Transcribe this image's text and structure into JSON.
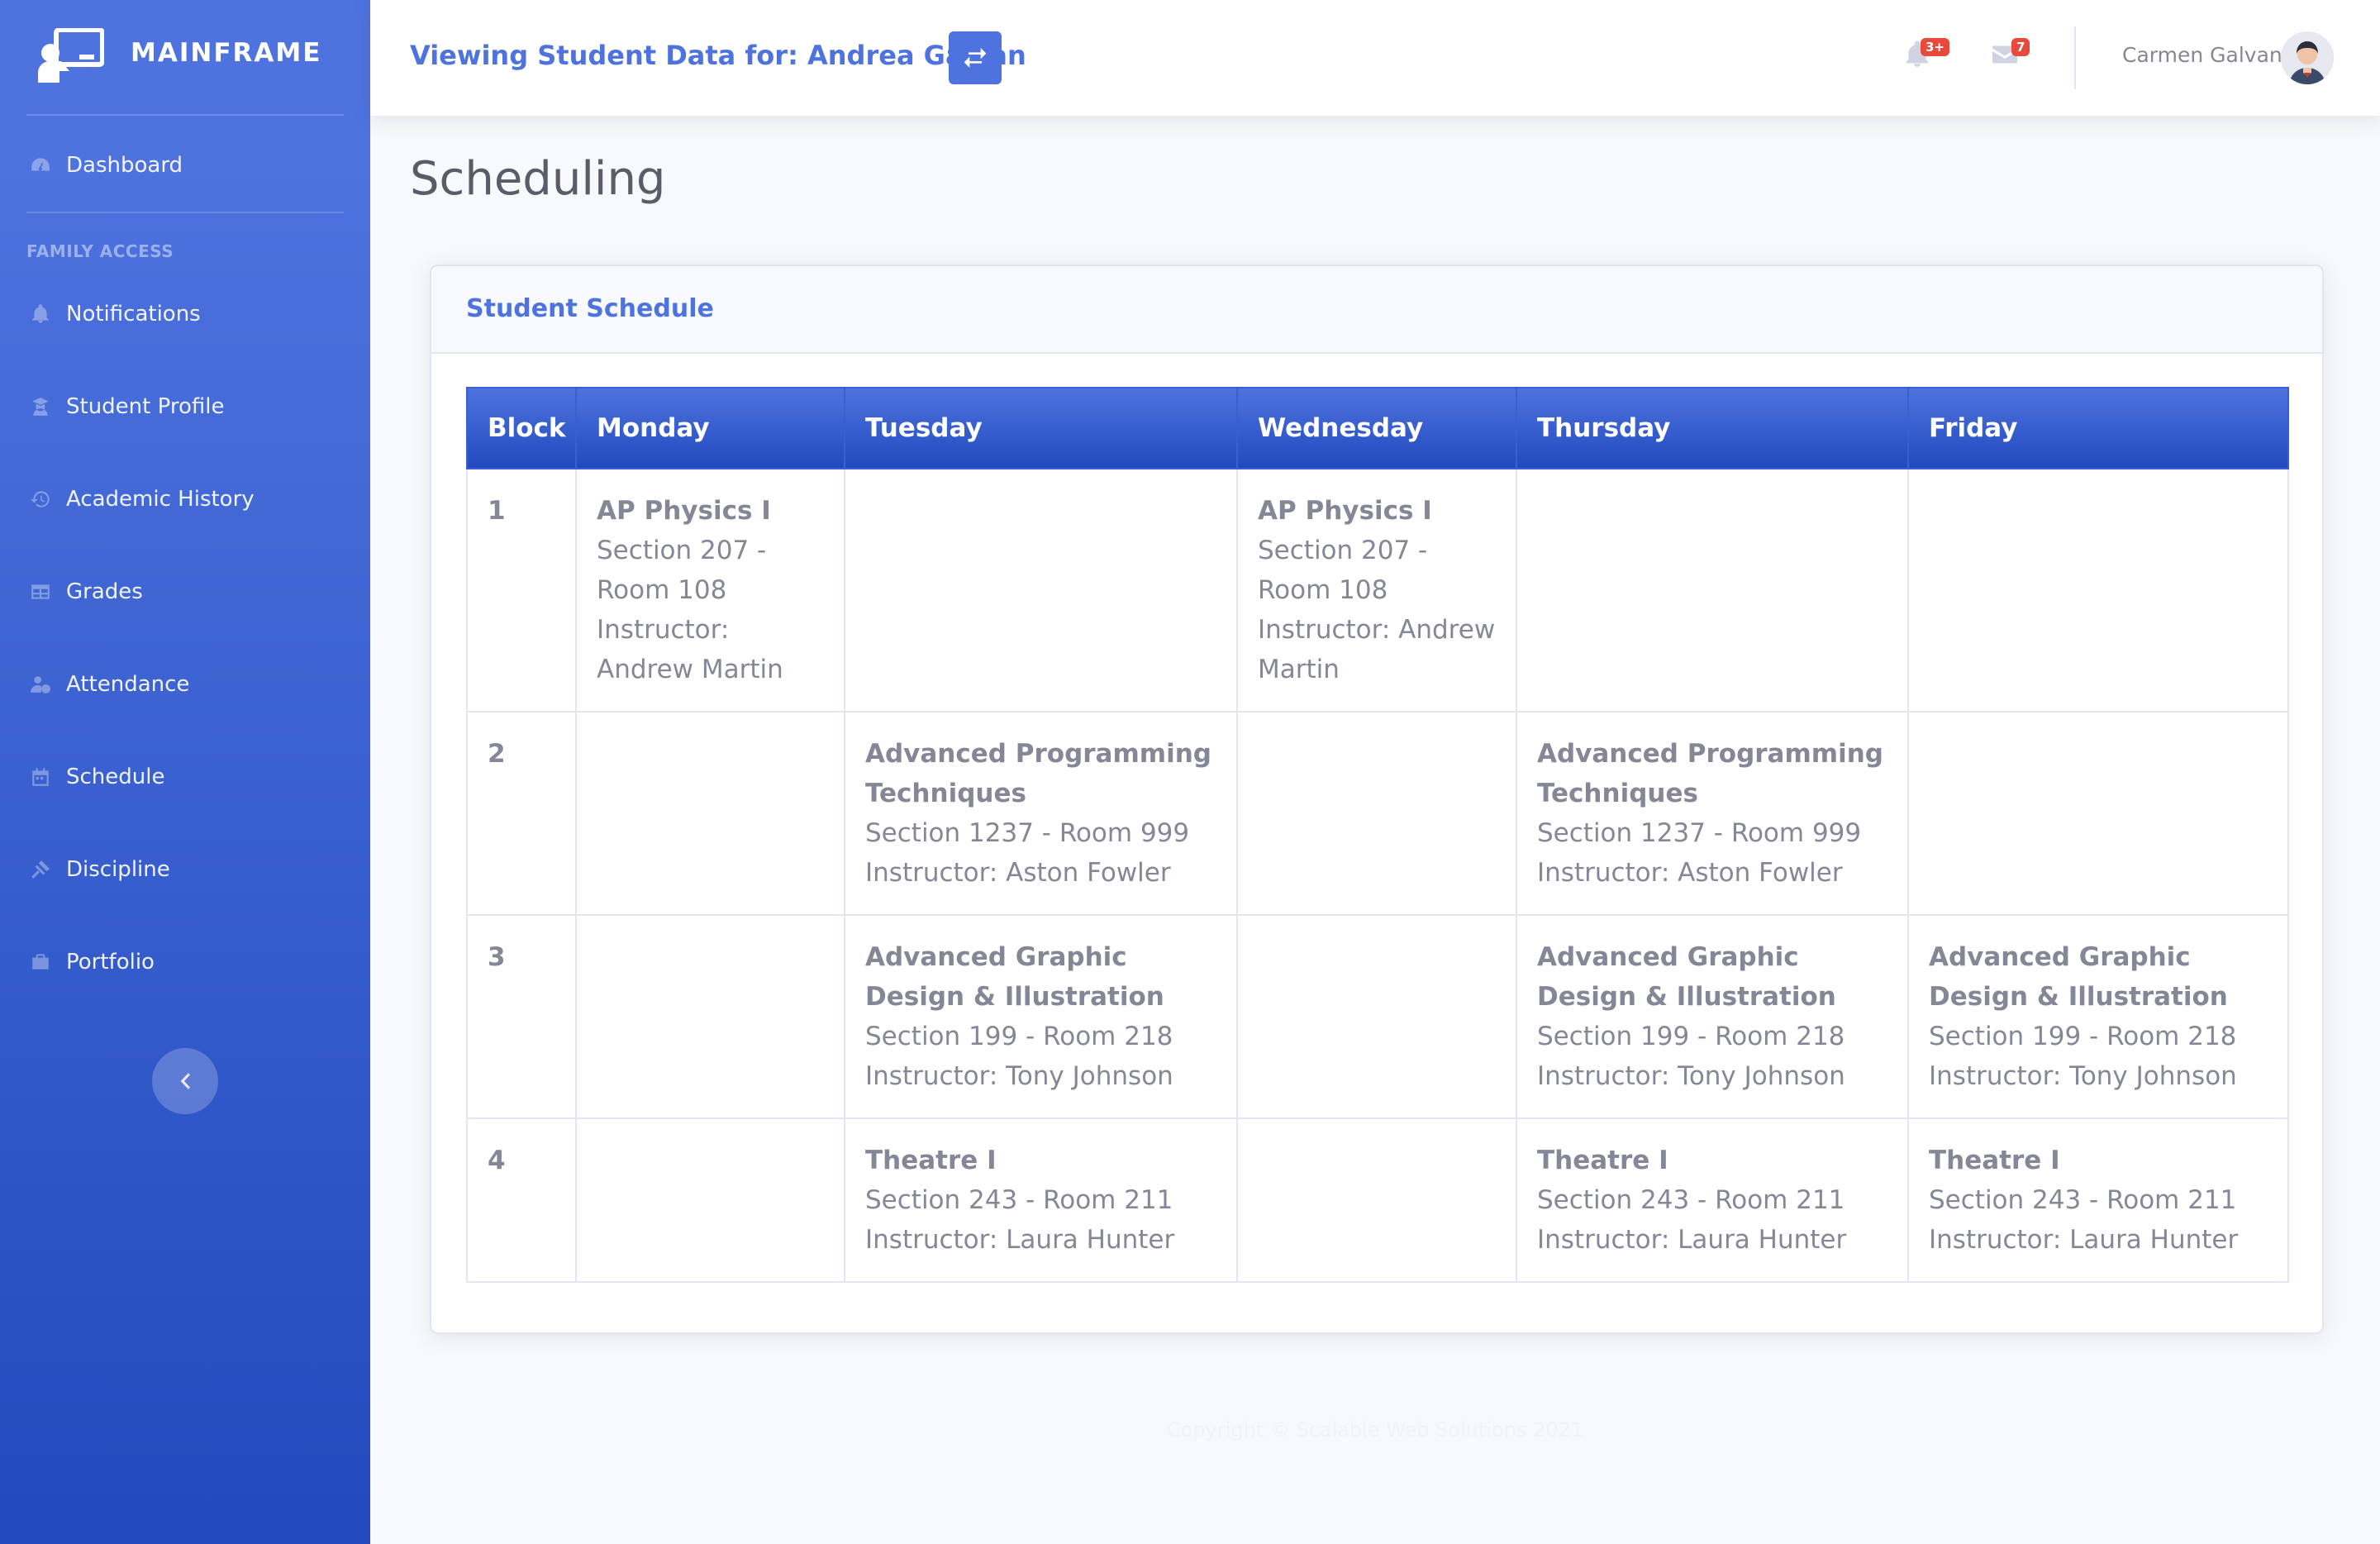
{
  "brand": {
    "name": "MAINFRAME",
    "icon": "chalkboard-teacher-icon"
  },
  "sidebar": {
    "dashboard": {
      "label": "Dashboard",
      "icon": "tachometer-icon"
    },
    "section_heading": "FAMILY ACCESS",
    "items": [
      {
        "label": "Notifications",
        "icon": "bell-icon"
      },
      {
        "label": "Student Profile",
        "icon": "user-graduate-icon"
      },
      {
        "label": "Academic History",
        "icon": "history-icon"
      },
      {
        "label": "Grades",
        "icon": "table-icon"
      },
      {
        "label": "Attendance",
        "icon": "user-clock-icon"
      },
      {
        "label": "Schedule",
        "icon": "calendar-icon"
      },
      {
        "label": "Discipline",
        "icon": "gavel-icon"
      },
      {
        "label": "Portfolio",
        "icon": "briefcase-icon"
      }
    ],
    "toggle_icon": "chevron-left-icon"
  },
  "topbar": {
    "viewing_text": "Viewing Student Data for: Andrea Galvan",
    "switch_icon": "exchange-icon",
    "alerts_badge": "3+",
    "messages_badge": "7",
    "user_name": "Carmen Galvan"
  },
  "page": {
    "title": "Scheduling"
  },
  "schedule": {
    "card_title": "Student Schedule",
    "headers": [
      "Block",
      "Monday",
      "Tuesday",
      "Wednesday",
      "Thursday",
      "Friday"
    ],
    "rows": [
      {
        "block": "1",
        "cells": [
          {
            "name": "AP Physics I",
            "section": "Section 207 - Room 108",
            "instructor": "Instructor: Andrew Martin"
          },
          null,
          {
            "name": "AP Physics I",
            "section": "Section 207 - Room 108",
            "instructor": "Instructor: Andrew Martin"
          },
          null,
          null
        ]
      },
      {
        "block": "2",
        "cells": [
          null,
          {
            "name": "Advanced Programming Techniques",
            "section": "Section 1237 - Room 999",
            "instructor": "Instructor: Aston Fowler"
          },
          null,
          {
            "name": "Advanced Programming Techniques",
            "section": "Section 1237 - Room 999",
            "instructor": "Instructor: Aston Fowler"
          },
          null
        ]
      },
      {
        "block": "3",
        "cells": [
          null,
          {
            "name": "Advanced Graphic Design & Illustration",
            "section": "Section 199 - Room 218",
            "instructor": "Instructor: Tony Johnson"
          },
          null,
          {
            "name": "Advanced Graphic Design & Illustration",
            "section": "Section 199 - Room 218",
            "instructor": "Instructor: Tony Johnson"
          },
          {
            "name": "Advanced Graphic Design & Illustration",
            "section": "Section 199 - Room 218",
            "instructor": "Instructor: Tony Johnson"
          }
        ]
      },
      {
        "block": "4",
        "cells": [
          null,
          {
            "name": "Theatre I",
            "section": "Section 243 - Room 211",
            "instructor": "Instructor: Laura Hunter"
          },
          null,
          {
            "name": "Theatre I",
            "section": "Section 243 - Room 211",
            "instructor": "Instructor: Laura Hunter"
          },
          {
            "name": "Theatre I",
            "section": "Section 243 - Room 211",
            "instructor": "Instructor: Laura Hunter"
          }
        ]
      }
    ]
  },
  "footer": {
    "text": "Copyright © Scalable Web Solutions 2021"
  }
}
